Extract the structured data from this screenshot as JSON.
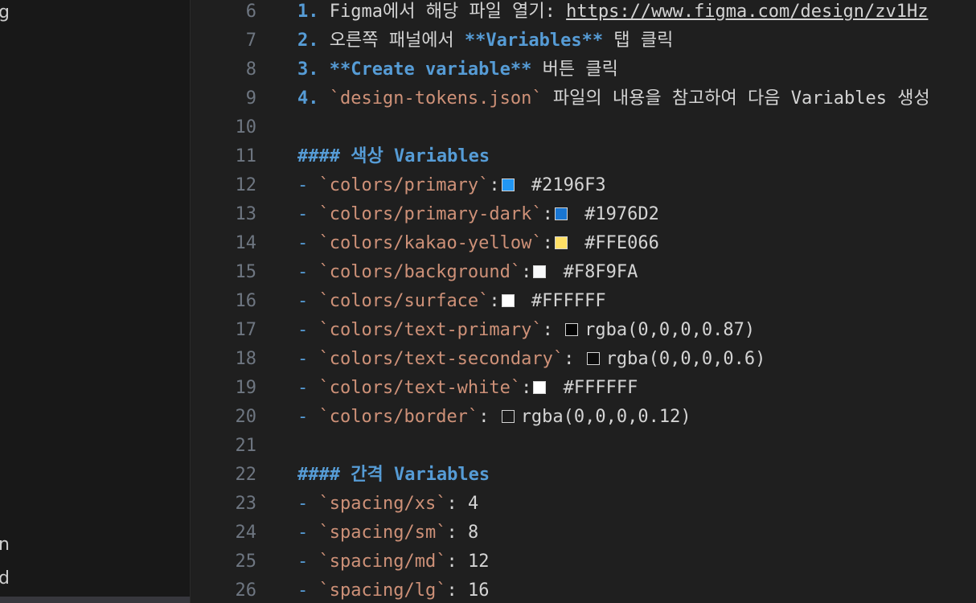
{
  "sidebar": {
    "fragments": [
      "g",
      "n",
      "d"
    ]
  },
  "editor": {
    "lines": [
      {
        "n": "6",
        "num": "1.",
        "pre": " ",
        "text": "Figma에서 해당 파일 열기: ",
        "link": "https://www.figma.com/design/zv1Hz"
      },
      {
        "n": "7",
        "num": "2.",
        "pre": " ",
        "text": "오른쪽 패널에서 ",
        "bold": "**Variables**",
        "post": " 탭 클릭"
      },
      {
        "n": "8",
        "num": "3.",
        "pre": " ",
        "bold": "**Create variable**",
        "post": " 버튼 클릭"
      },
      {
        "n": "9",
        "num": "4.",
        "pre": " ",
        "tick": "`design-tokens.json`",
        "post": " 파일의 내용을 참고하여 다음 Variables 생성"
      },
      {
        "n": "10"
      },
      {
        "n": "11",
        "heading": "#### 색상 Variables"
      },
      {
        "n": "12",
        "dash": "- ",
        "tick": "`colors/primary`",
        "colon": ":",
        "swatch": "#2196F3",
        "value": " #2196F3"
      },
      {
        "n": "13",
        "dash": "- ",
        "tick": "`colors/primary-dark`",
        "colon": ":",
        "swatch": "#1976D2",
        "value": " #1976D2"
      },
      {
        "n": "14",
        "dash": "- ",
        "tick": "`colors/kakao-yellow`",
        "colon": ":",
        "swatch": "#FFE066",
        "value": " #FFE066"
      },
      {
        "n": "15",
        "dash": "- ",
        "tick": "`colors/background`",
        "colon": ":",
        "swatch": "#F8F9FA",
        "value": " #F8F9FA"
      },
      {
        "n": "16",
        "dash": "- ",
        "tick": "`colors/surface`",
        "colon": ":",
        "swatch": "#FFFFFF",
        "value": " #FFFFFF"
      },
      {
        "n": "17",
        "dash": "- ",
        "tick": "`colors/text-primary`",
        "colon": ": ",
        "swatch": "rgba(0,0,0,0.87)",
        "value": "rgba(0,0,0,0.87)"
      },
      {
        "n": "18",
        "dash": "- ",
        "tick": "`colors/text-secondary`",
        "colon": ": ",
        "swatch": "rgba(0,0,0,0.6)",
        "value": "rgba(0,0,0,0.6)"
      },
      {
        "n": "19",
        "dash": "- ",
        "tick": "`colors/text-white`",
        "colon": ":",
        "swatch": "#FFFFFF",
        "value": " #FFFFFF"
      },
      {
        "n": "20",
        "dash": "- ",
        "tick": "`colors/border`",
        "colon": ": ",
        "swatch": "rgba(0,0,0,0.12)",
        "value": "rgba(0,0,0,0.12)"
      },
      {
        "n": "21"
      },
      {
        "n": "22",
        "heading": "#### 간격 Variables"
      },
      {
        "n": "23",
        "dash": "- ",
        "tick": "`spacing/xs`",
        "colon": ": ",
        "value": "4"
      },
      {
        "n": "24",
        "dash": "- ",
        "tick": "`spacing/sm`",
        "colon": ": ",
        "value": "8"
      },
      {
        "n": "25",
        "dash": "- ",
        "tick": "`spacing/md`",
        "colon": ": ",
        "value": "12"
      },
      {
        "n": "26",
        "dash": "- ",
        "tick": "`spacing/lg`",
        "colon": ": ",
        "value": "16"
      }
    ]
  }
}
